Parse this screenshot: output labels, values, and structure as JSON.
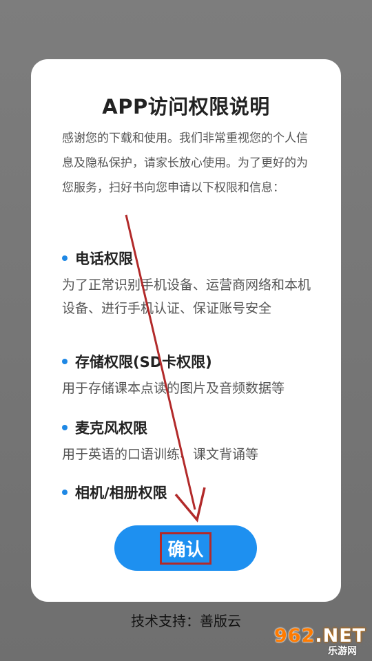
{
  "dialog": {
    "title": "APP访问权限说明",
    "intro": "感谢您的下载和使用。我们非常重视您的个人信息及隐私保护，请家长放心使用。为了更好的为您服务，扫好书向您申请以下权限和信息：",
    "permissions": [
      {
        "title": "电话权限",
        "desc": "为了正常识别手机设备、运营商网络和本机设备、进行手机认证、保证账号安全"
      },
      {
        "title": "存储权限(SD卡权限)",
        "desc": "用于存储课本点读的图片及音频数据等"
      },
      {
        "title": "麦克风权限",
        "desc": "用于英语的口语训练、课文背诵等"
      },
      {
        "title": "相机/相册权限",
        "desc": ""
      }
    ],
    "confirm_label": "确认"
  },
  "footer": "技术支持：善版云",
  "watermark": {
    "num": "962",
    "suffix": ".NET",
    "sub": "乐游网"
  },
  "colors": {
    "accent": "#1e90f0",
    "dot": "#1e88e5",
    "annotation": "#b22a2a",
    "backdrop": "#777777"
  },
  "annotation": {
    "icon": "red-arrow-icon"
  }
}
